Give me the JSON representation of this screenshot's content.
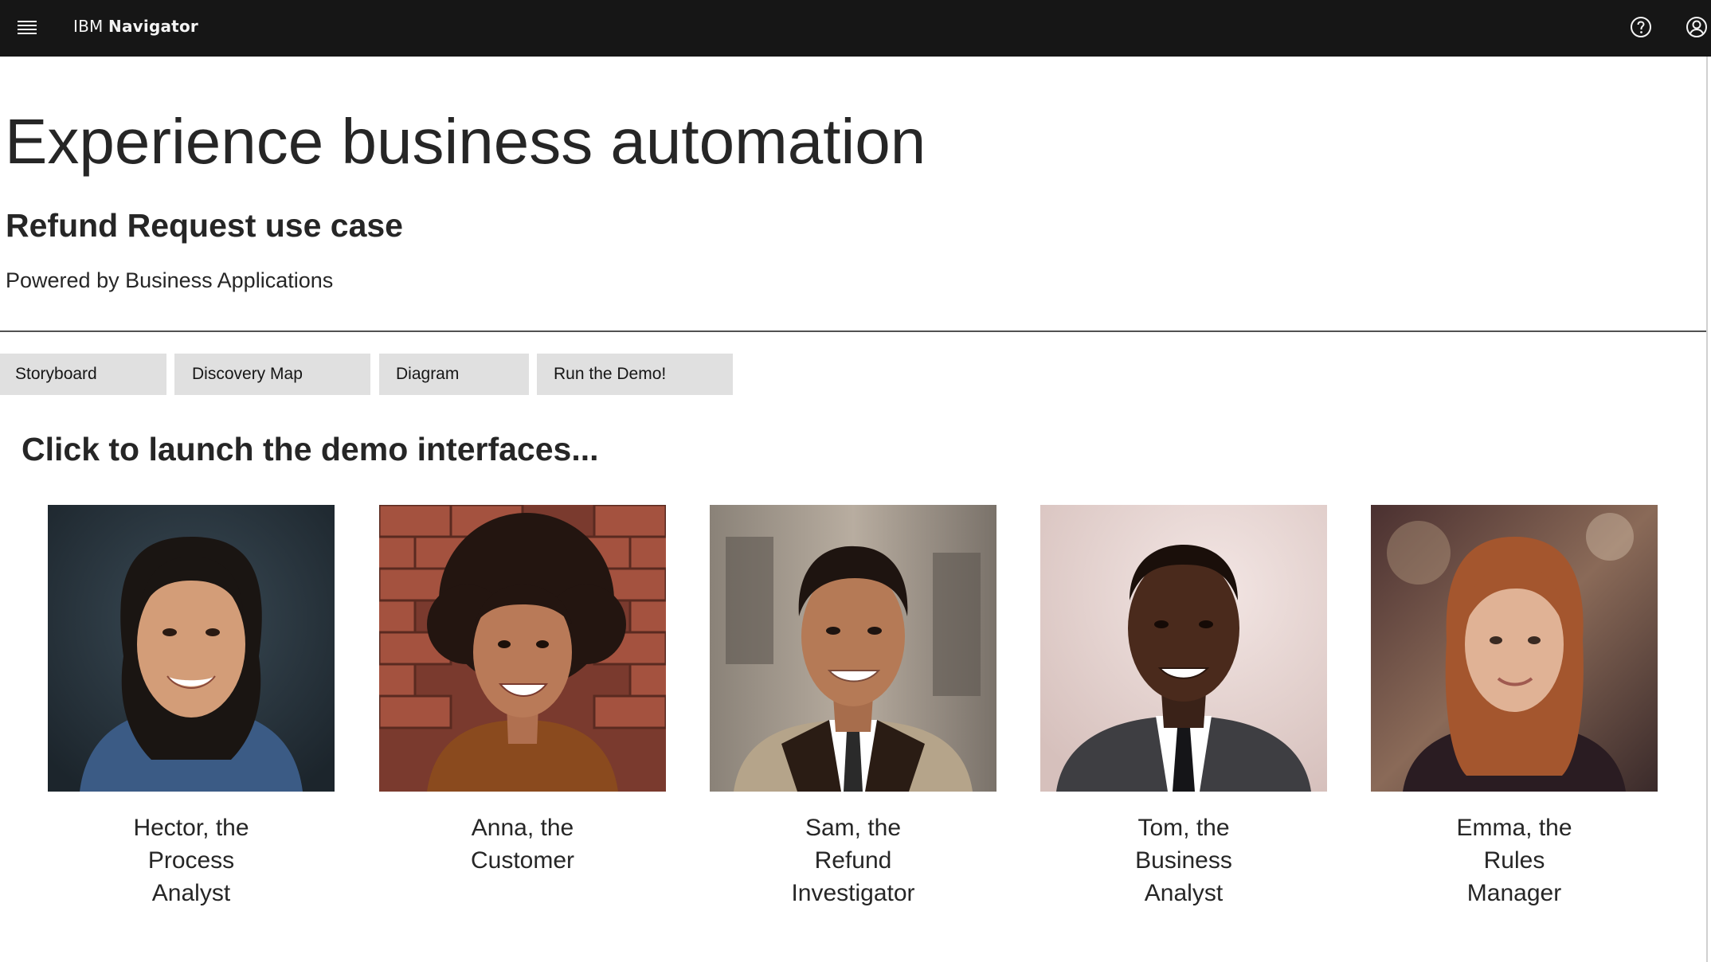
{
  "topbar": {
    "brand_prefix": "IBM",
    "brand_name": "Navigator",
    "menu_icon": "hamburger-menu-icon",
    "help_icon": "help-icon",
    "user_icon": "user-avatar-icon",
    "background": "#161616"
  },
  "hero": {
    "title": "Experience business automation",
    "subtitle": "Refund Request use case",
    "powered_by": "Powered by Business Applications"
  },
  "tabs": [
    {
      "label": "Storyboard"
    },
    {
      "label": "Discovery Map"
    },
    {
      "label": "Diagram"
    },
    {
      "label": "Run the Demo!"
    }
  ],
  "section": {
    "title": "Click to launch the demo interfaces..."
  },
  "personas": [
    {
      "line1": "Hector, the",
      "line2": "Process",
      "line3": "Analyst"
    },
    {
      "line1": "Anna, the",
      "line2": "Customer",
      "line3": ""
    },
    {
      "line1": "Sam, the",
      "line2": "Refund",
      "line3": "Investigator"
    },
    {
      "line1": "Tom, the",
      "line2": "Business",
      "line3": "Analyst"
    },
    {
      "line1": "Emma, the",
      "line2": "Rules",
      "line3": "Manager"
    }
  ],
  "colors": {
    "tab_background": "#e0e0e0",
    "text": "#262626",
    "divider": "#525252"
  }
}
